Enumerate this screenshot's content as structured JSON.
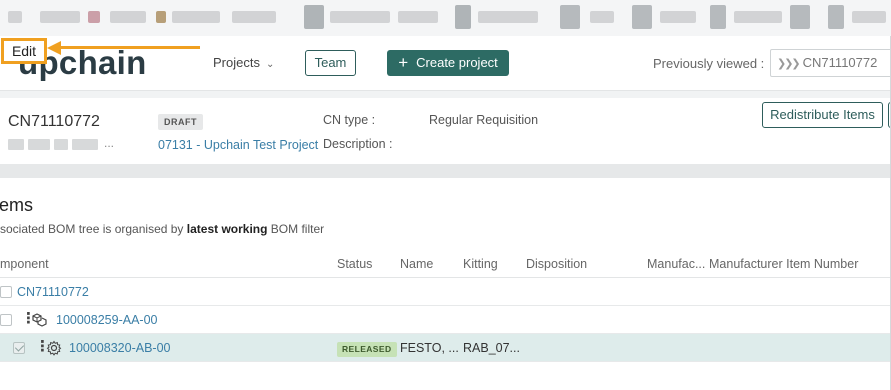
{
  "app": {
    "logo": "upchain",
    "nav_projects": "Projects",
    "team_button": "Team",
    "create_project_button": "Create project",
    "previously_viewed_label": "Previously viewed :",
    "previously_viewed_value": "CN71110772"
  },
  "annotation": {
    "tooltip": "Edit"
  },
  "change_notice": {
    "id": "CN71110772",
    "subtitle_suffix": "...",
    "status": "DRAFT",
    "project_link": "07131 - Upchain Test Project",
    "cn_type_label": "CN type :",
    "cn_type_value": "Regular Requisition",
    "description_label": "Description :",
    "redistribute_button": "Redistribute Items"
  },
  "items": {
    "title": "ems",
    "description_prefix": "sociated BOM tree is organised by ",
    "description_bold": "latest working",
    "description_suffix": " BOM filter",
    "columns": {
      "component": "mponent",
      "status": "Status",
      "name": "Name",
      "kitting": "Kitting",
      "disposition": "Disposition",
      "manufacturer": "Manufac...",
      "manufacturer_item_number": "Manufacturer Item Number"
    },
    "rows": [
      {
        "component": "CN71110772"
      },
      {
        "component": "100008259-AA-00",
        "icon": "assembly-icon"
      },
      {
        "component": "100008320-AB-00",
        "icon": "part-gear-icon",
        "status": "RELEASED",
        "name": "FESTO, ...",
        "kitting": "RAB_07...",
        "selected": true
      }
    ]
  },
  "colors": {
    "brand_teal": "#2d6b64",
    "link_blue": "#3a7ea6",
    "annotation_orange": "#f0a020",
    "released_green": "#c6e2b6",
    "selected_row": "#deeceb"
  }
}
